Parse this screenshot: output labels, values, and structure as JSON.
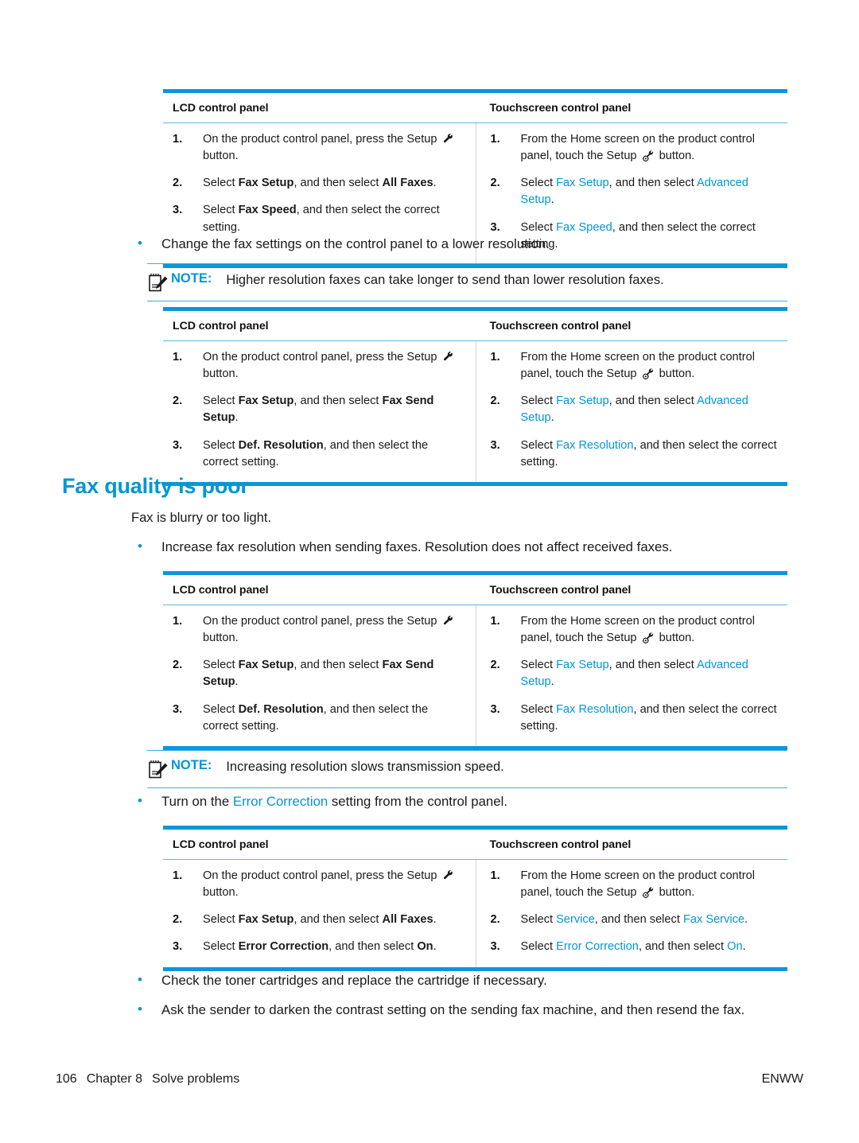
{
  "page": {
    "footer_page_number": "106",
    "footer_chapter": "Chapter 8",
    "footer_section": "Solve problems",
    "footer_right": "ENWW",
    "accent_color": "#0096d6",
    "table_rule_color": "#0d96d9",
    "text_color": "#1a1a1a"
  },
  "table1": {
    "header_left": "LCD control panel",
    "header_right": "Touchscreen control panel",
    "lcd_steps": [
      {
        "num": "1.",
        "text": "On the product control panel, press the Setup ⌁ button."
      },
      {
        "num": "2.",
        "text": "Select Fax Setup, and then select All Faxes."
      },
      {
        "num": "3.",
        "text": "Select Fax Speed, and then select the correct setting."
      }
    ],
    "touch_steps": [
      {
        "num": "1.",
        "text": "From the Home screen on the product control panel, touch the Setup ⌁ button."
      },
      {
        "num": "2.",
        "text": "Select Fax Setup, and then select Advanced Setup."
      },
      {
        "num": "3.",
        "text": "Select Fax Speed, and then select the correct setting."
      }
    ]
  },
  "bullet1": "Change the fax settings on the control panel to a lower resolution.",
  "note1": {
    "label": "NOTE:",
    "text": "Higher resolution faxes can take longer to send than lower resolution faxes."
  },
  "table2": {
    "header_left": "LCD control panel",
    "header_right": "Touchscreen control panel",
    "lcd_steps": [
      {
        "num": "1.",
        "text": "On the product control panel, press the Setup ⌁ button."
      },
      {
        "num": "2.",
        "text": "Select Fax Setup, and then select Fax Send Setup."
      },
      {
        "num": "3.",
        "text": "Select Def. Resolution, and then select the correct setting."
      }
    ],
    "touch_steps": [
      {
        "num": "1.",
        "text": "From the Home screen on the product control panel, touch the Setup ⌁ button."
      },
      {
        "num": "2.",
        "text": "Select Fax Setup, and then select Advanced Setup."
      },
      {
        "num": "3.",
        "text": "Select Fax Resolution, and then select the correct setting."
      }
    ]
  },
  "heading": "Fax quality is poor",
  "intro": "Fax is blurry or too light.",
  "bullet2": "Increase fax resolution when sending faxes. Resolution does not affect received faxes.",
  "table3": {
    "header_left": "LCD control panel",
    "header_right": "Touchscreen control panel",
    "lcd_steps": [
      {
        "num": "1.",
        "text": "On the product control panel, press the Setup ⌁ button."
      },
      {
        "num": "2.",
        "text": "Select Fax Setup, and then select Fax Send Setup."
      },
      {
        "num": "3.",
        "text": "Select Def. Resolution, and then select the correct setting."
      }
    ],
    "touch_steps": [
      {
        "num": "1.",
        "text": "From the Home screen on the product control panel, touch the Setup ⌁ button."
      },
      {
        "num": "2.",
        "text": "Select Fax Setup, and then select Advanced Setup."
      },
      {
        "num": "3.",
        "text": "Select Fax Resolution, and then select the correct setting."
      }
    ]
  },
  "note2": {
    "label": "NOTE:",
    "text": "Increasing resolution slows transmission speed."
  },
  "bullet3": {
    "before": "Turn on the ",
    "link": "Error Correction",
    "after": " setting from the control panel."
  },
  "table4": {
    "header_left": "LCD control panel",
    "header_right": "Touchscreen control panel",
    "lcd_steps": [
      {
        "num": "1.",
        "text": "On the product control panel, press the Setup ⌁ button."
      },
      {
        "num": "2.",
        "text": "Select Fax Setup, and then select All Faxes."
      },
      {
        "num": "3.",
        "text": "Select Error Correction, and then select On."
      }
    ],
    "touch_steps": [
      {
        "num": "1.",
        "text": "From the Home screen on the product control panel, touch the Setup ⌁ button."
      },
      {
        "num": "2.",
        "text": "Select Service, and then select Fax Service."
      },
      {
        "num": "3.",
        "text": "Select Error Correction, and then select On."
      }
    ]
  },
  "bullet4": "Check the toner cartridges and replace the cartridge if necessary.",
  "bullet5": "Ask the sender to darken the contrast setting on the sending fax machine, and then resend the fax.",
  "icons": {
    "note": "notepad-pencil-icon",
    "lcd_setup": "wrench-icon",
    "touch_setup": "wrench-gear-icon",
    "bullet": "bullet-dot-icon"
  },
  "labels": {
    "bullet_glyph": "•"
  }
}
